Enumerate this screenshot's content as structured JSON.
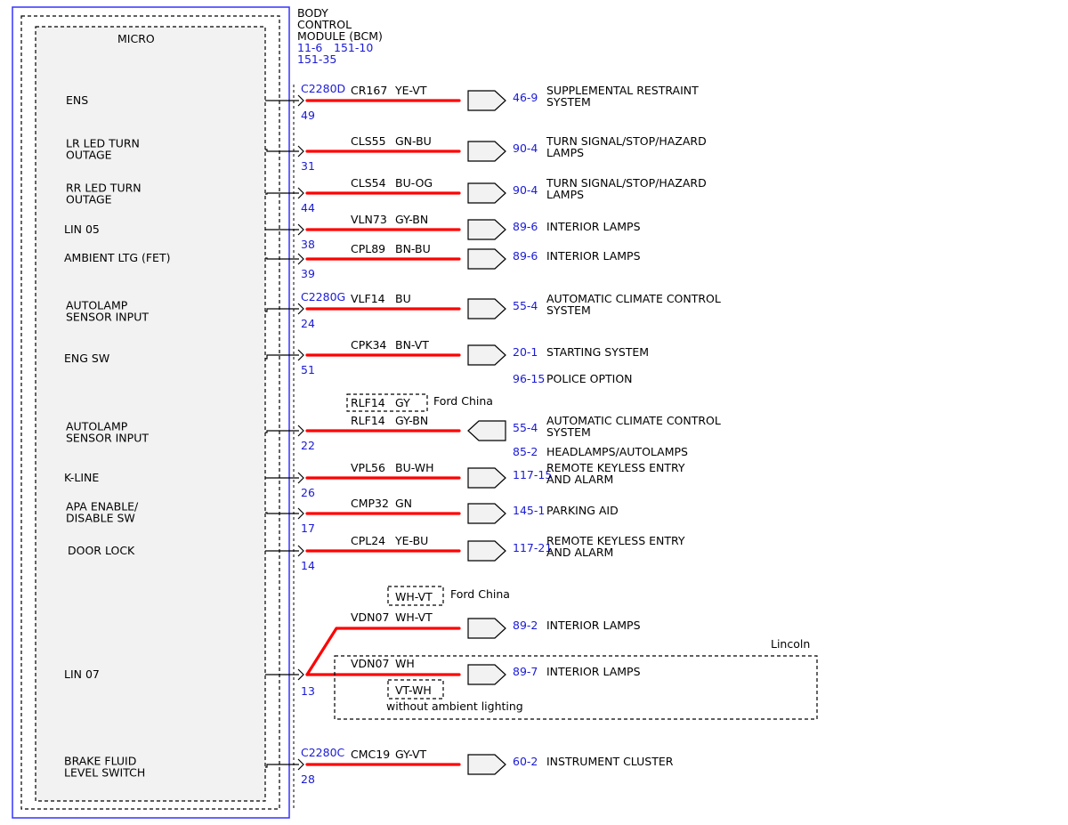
{
  "module": {
    "title_lines": [
      "BODY",
      "CONTROL",
      "MODULE (BCM)"
    ],
    "refs_line1": [
      "11-6",
      "151-10"
    ],
    "refs_line2": "151-35",
    "micro_label": "MICRO"
  },
  "colors": {
    "wire": "#ff0000",
    "ref_blue": "#1a1ad6",
    "module_border": "#3333ff",
    "module_fill": "#f2f2f2"
  },
  "inputs": [
    {
      "lines": [
        "ENS"
      ]
    },
    {
      "lines": [
        "LR LED TURN",
        "OUTAGE"
      ]
    },
    {
      "lines": [
        "RR LED TURN",
        "OUTAGE"
      ]
    },
    {
      "lines": [
        "LIN 05"
      ]
    },
    {
      "lines": [
        "AMBIENT LTG (FET)"
      ]
    },
    {
      "lines": [
        "AUTOLAMP",
        "SENSOR INPUT"
      ]
    },
    {
      "lines": [
        "ENG SW"
      ]
    },
    {
      "lines": [
        "AUTOLAMP",
        "SENSOR INPUT"
      ]
    },
    {
      "lines": [
        "K-LINE"
      ]
    },
    {
      "lines": [
        "APA ENABLE/",
        "DISABLE SW"
      ]
    },
    {
      "lines": [
        "DOOR LOCK"
      ]
    },
    {
      "lines": [
        "LIN 07"
      ]
    },
    {
      "lines": [
        "BRAKE FLUID",
        "LEVEL SWITCH"
      ]
    }
  ],
  "circuits": [
    {
      "connector": "C2280D",
      "pin": "49",
      "circuit": "CR167",
      "color": "YE-VT",
      "ref": "46-9",
      "dest": [
        "SUPPLEMENTAL RESTRAINT",
        "SYSTEM"
      ]
    },
    {
      "pin": "31",
      "circuit": "CLS55",
      "color": "GN-BU",
      "ref": "90-4",
      "dest": [
        "TURN SIGNAL/STOP/HAZARD",
        "LAMPS"
      ]
    },
    {
      "pin": "44",
      "circuit": "CLS54",
      "color": "BU-OG",
      "ref": "90-4",
      "dest": [
        "TURN SIGNAL/STOP/HAZARD",
        "LAMPS"
      ]
    },
    {
      "pin": "38",
      "circuit": "VLN73",
      "color": "GY-BN",
      "ref": "89-6",
      "dest": [
        "INTERIOR LAMPS"
      ]
    },
    {
      "pin": "39",
      "circuit": "CPL89",
      "color": "BN-BU",
      "ref": "89-6",
      "dest": [
        "INTERIOR LAMPS"
      ]
    },
    {
      "connector": "C2280G",
      "pin": "24",
      "circuit": "VLF14",
      "color": "BU",
      "ref": "55-4",
      "dest": [
        "AUTOMATIC CLIMATE CONTROL",
        "SYSTEM"
      ]
    },
    {
      "pin": "51",
      "circuit": "CPK34",
      "color": "BN-VT",
      "ref": "20-1",
      "dest": [
        "STARTING SYSTEM"
      ],
      "extra_ref": "96-15",
      "extra_dest": "POLICE OPTION"
    },
    {
      "pin": "22",
      "circuit": "RLF14",
      "color": "GY-BN",
      "alt_box": {
        "circuit": "RLF14",
        "color": "GY"
      },
      "alt_note": "Ford China",
      "ref": "55-4",
      "dest": [
        "AUTOMATIC CLIMATE CONTROL",
        "SYSTEM"
      ],
      "extra_ref": "85-2",
      "extra_dest": "HEADLAMPS/AUTOLAMPS"
    },
    {
      "pin": "26",
      "circuit": "VPL56",
      "color": "BU-WH",
      "ref": "117-15",
      "dest": [
        "REMOTE KEYLESS ENTRY",
        "AND ALARM"
      ]
    },
    {
      "pin": "17",
      "circuit": "CMP32",
      "color": "GN",
      "ref": "145-1",
      "dest": [
        "PARKING AID"
      ]
    },
    {
      "pin": "14",
      "circuit": "CPL24",
      "color": "YE-BU",
      "ref": "117-21",
      "dest": [
        "REMOTE KEYLESS ENTRY",
        "AND ALARM"
      ]
    },
    {
      "pin": "13",
      "branches": [
        {
          "circuit": "VDN07",
          "color": "WH-VT",
          "ref": "89-2",
          "dest": "INTERIOR LAMPS",
          "alt_box": "WH-VT",
          "alt_note": "Ford China"
        },
        {
          "circuit": "VDN07",
          "color": "WH",
          "ref": "89-7",
          "dest": "INTERIOR LAMPS",
          "alt_box": "VT-WH",
          "alt_note": "without ambient lighting",
          "group_label": "Lincoln"
        }
      ]
    },
    {
      "connector": "C2280C",
      "pin": "28",
      "circuit": "CMC19",
      "color": "GY-VT",
      "ref": "60-2",
      "dest": [
        "INSTRUMENT CLUSTER"
      ]
    }
  ]
}
